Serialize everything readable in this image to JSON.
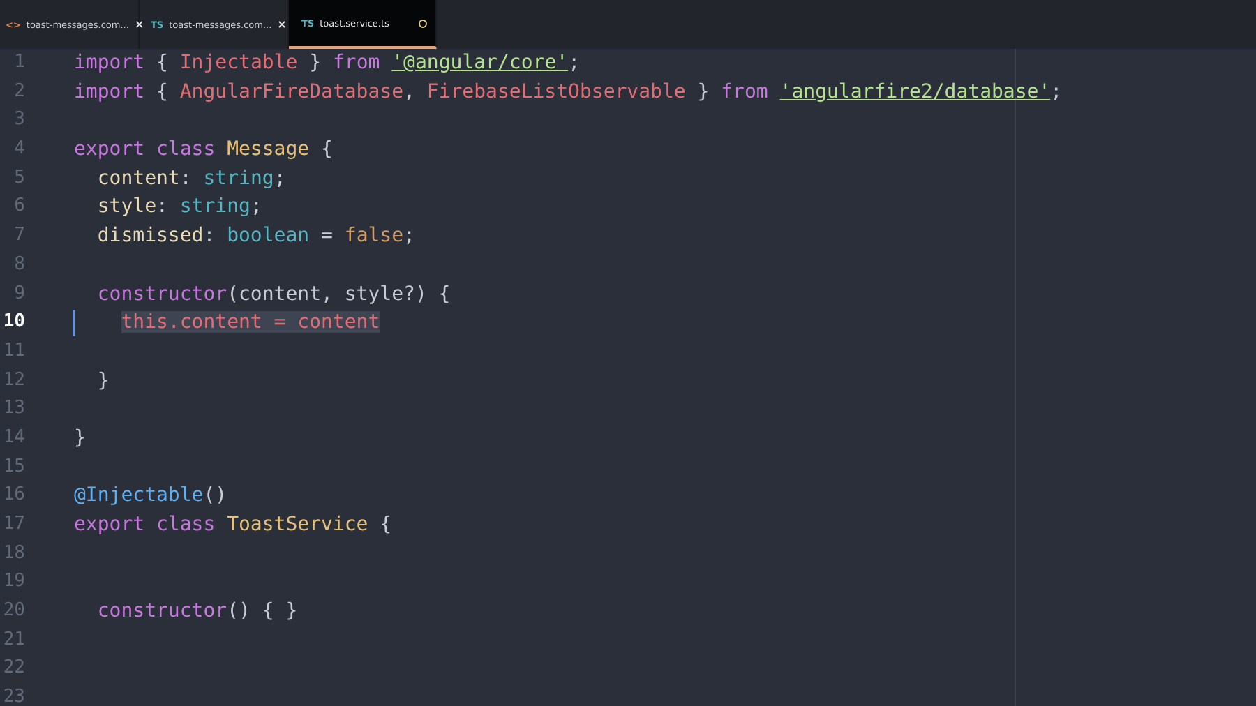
{
  "tabs": [
    {
      "icon": "<>",
      "color": "#e8834a",
      "label": "toast-messages.com...",
      "close": "×",
      "selected": false,
      "modified": false
    },
    {
      "icon": "TS",
      "color": "#56b6c2",
      "label": "toast-messages.com...",
      "close": "×",
      "selected": false,
      "modified": false
    },
    {
      "icon": "TS",
      "color": "#56b6c2",
      "label": "toast.service.ts",
      "selected": true,
      "modified": true
    }
  ],
  "lines": [
    {
      "number": "1",
      "selected": false,
      "tokens": [
        {
          "kind": "kw",
          "text": "import"
        },
        {
          "kind": "plain",
          "text": " { "
        },
        {
          "kind": "ident",
          "text": "Injectable"
        },
        {
          "kind": "plain",
          "text": " } "
        },
        {
          "kind": "kw",
          "text": "from "
        },
        {
          "kind": "str",
          "text": "'@angular/core'"
        },
        {
          "kind": "plain",
          "text": ";"
        }
      ]
    },
    {
      "number": "2",
      "selected": false,
      "tokens": [
        {
          "kind": "kw",
          "text": "import"
        },
        {
          "kind": "plain",
          "text": " { "
        },
        {
          "kind": "ident",
          "text": "AngularFireDatabase"
        },
        {
          "kind": "plain",
          "text": ", "
        },
        {
          "kind": "ident",
          "text": "FirebaseListObservable"
        },
        {
          "kind": "plain",
          "text": " } "
        },
        {
          "kind": "kw",
          "text": "from "
        },
        {
          "kind": "str",
          "text": "'angularfire2/database'"
        },
        {
          "kind": "plain",
          "text": ";"
        }
      ]
    },
    {
      "number": "3",
      "selected": false
    },
    {
      "number": "4",
      "selected": false,
      "tokens": [
        {
          "kind": "kw",
          "text": "export class "
        },
        {
          "kind": "type",
          "text": "Message"
        },
        {
          "kind": "plain",
          "text": " {"
        }
      ]
    },
    {
      "number": "5",
      "selected": false,
      "tokens": [
        {
          "kind": "prop",
          "text": "  content"
        },
        {
          "kind": "plain",
          "text": ": "
        },
        {
          "kind": "builtin",
          "text": "string"
        },
        {
          "kind": "plain",
          "text": ";"
        }
      ]
    },
    {
      "number": "6",
      "selected": false,
      "tokens": [
        {
          "kind": "prop",
          "text": "  style"
        },
        {
          "kind": "plain",
          "text": ": "
        },
        {
          "kind": "builtin",
          "text": "string"
        },
        {
          "kind": "plain",
          "text": ";"
        }
      ]
    },
    {
      "number": "7",
      "selected": false,
      "tokens": [
        {
          "kind": "prop",
          "text": "  dismissed"
        },
        {
          "kind": "plain",
          "text": ": "
        },
        {
          "kind": "builtin",
          "text": "boolean"
        },
        {
          "kind": "plain",
          "text": " = "
        },
        {
          "kind": "const",
          "text": "false"
        },
        {
          "kind": "plain",
          "text": ";"
        }
      ]
    },
    {
      "number": "8",
      "selected": false
    },
    {
      "number": "9",
      "selected": false,
      "tokens": [
        {
          "kind": "kw",
          "text": "  constructor"
        },
        {
          "kind": "plain",
          "text": "(content, style?) {"
        }
      ]
    },
    {
      "number": "10",
      "selected": true,
      "tokens": [
        {
          "kind": "ident",
          "text": "    this.content = content"
        }
      ]
    },
    {
      "number": "11",
      "selected": false
    },
    {
      "number": "12",
      "selected": false,
      "tokens": [
        {
          "kind": "plain",
          "text": "  }"
        }
      ]
    },
    {
      "number": "13",
      "selected": false
    },
    {
      "number": "14",
      "selected": false,
      "tokens": [
        {
          "kind": "plain",
          "text": "}"
        }
      ]
    },
    {
      "number": "15",
      "selected": false
    },
    {
      "number": "16",
      "selected": false,
      "tokens": [
        {
          "kind": "deco",
          "text": "@Injectable"
        },
        {
          "kind": "plain",
          "text": "()"
        }
      ]
    },
    {
      "number": "17",
      "selected": false,
      "tokens": [
        {
          "kind": "kw",
          "text": "export class "
        },
        {
          "kind": "type",
          "text": "ToastService"
        },
        {
          "kind": "plain",
          "text": " {"
        }
      ]
    },
    {
      "number": "18",
      "selected": false
    },
    {
      "number": "19",
      "selected": false
    },
    {
      "number": "20",
      "selected": false,
      "tokens": [
        {
          "kind": "kw",
          "text": "  constructor"
        },
        {
          "kind": "plain",
          "text": "() { }"
        }
      ]
    },
    {
      "number": "21",
      "selected": false
    },
    {
      "number": "22",
      "selected": false
    },
    {
      "number": "23",
      "selected": false
    }
  ]
}
